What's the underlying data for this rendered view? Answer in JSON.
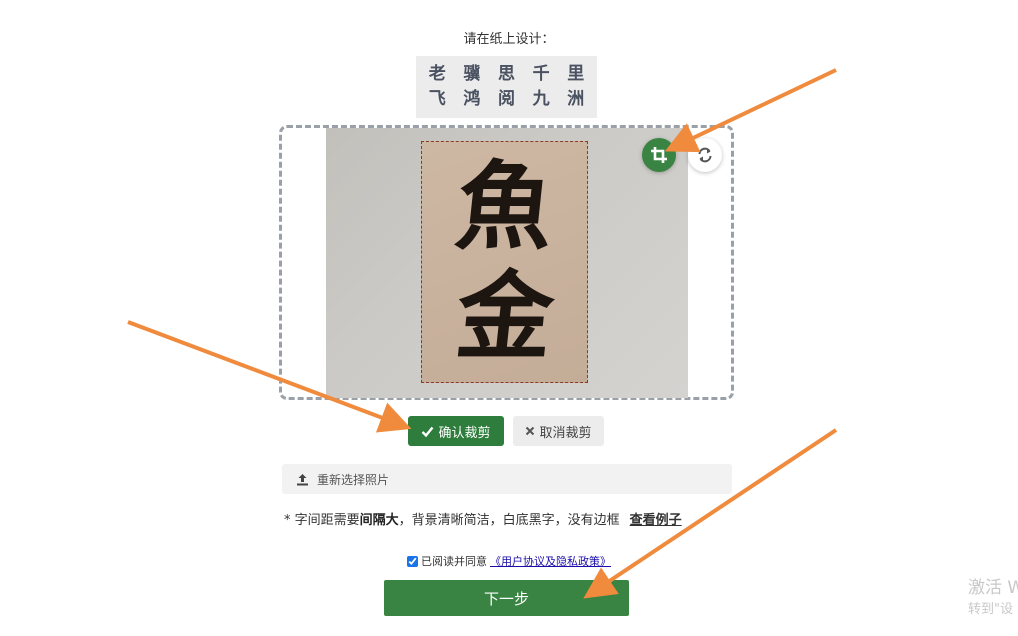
{
  "prompt": "请在纸上设计：",
  "sample_chars": [
    "老",
    "骥",
    "思",
    "千",
    "里",
    "飞",
    "鸿",
    "阅",
    "九",
    "洲"
  ],
  "photo": {
    "calligraphy": [
      "魚",
      "金"
    ]
  },
  "tool_buttons": {
    "crop_icon": "crop-icon",
    "rotate_icon": "rotate-icon"
  },
  "actions": {
    "confirm_label": "确认裁剪",
    "cancel_label": "取消裁剪"
  },
  "reselect": {
    "label": "重新选择照片"
  },
  "tip": {
    "prefix": "* 字间距需要",
    "bold": "间隔大",
    "suffix": "，背景清晰简洁，白底黑字，没有边框",
    "example_link": "查看例子"
  },
  "agreement": {
    "text": "已阅读并同意",
    "link": "《用户协议及隐私政策》",
    "checked": true
  },
  "next_label": "下一步",
  "watermark": {
    "line1": "激活 W",
    "line2": "转到\"设"
  },
  "colors": {
    "primary_green": "#3a8443",
    "annotation_orange": "#f08a3c"
  }
}
